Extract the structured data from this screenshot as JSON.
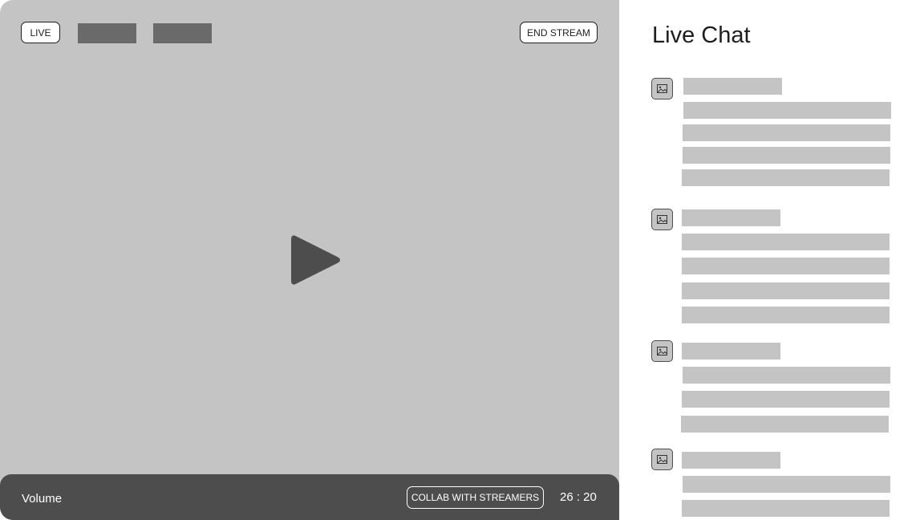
{
  "stream": {
    "live_label": "LIVE",
    "end_label": "END STREAM",
    "play_icon": "play-icon"
  },
  "controls": {
    "volume_label": "Volume",
    "collab_label": "COLLAB WITH STREAMERS",
    "timer": "26 : 20"
  },
  "chat": {
    "title": "Live Chat",
    "avatar_icon": "image-placeholder-icon"
  },
  "colors": {
    "stage": "#c4c4c4",
    "control_bar": "#4d4d4d",
    "placeholder_block": "#6a6a6a",
    "text": "#1e1e1e"
  }
}
